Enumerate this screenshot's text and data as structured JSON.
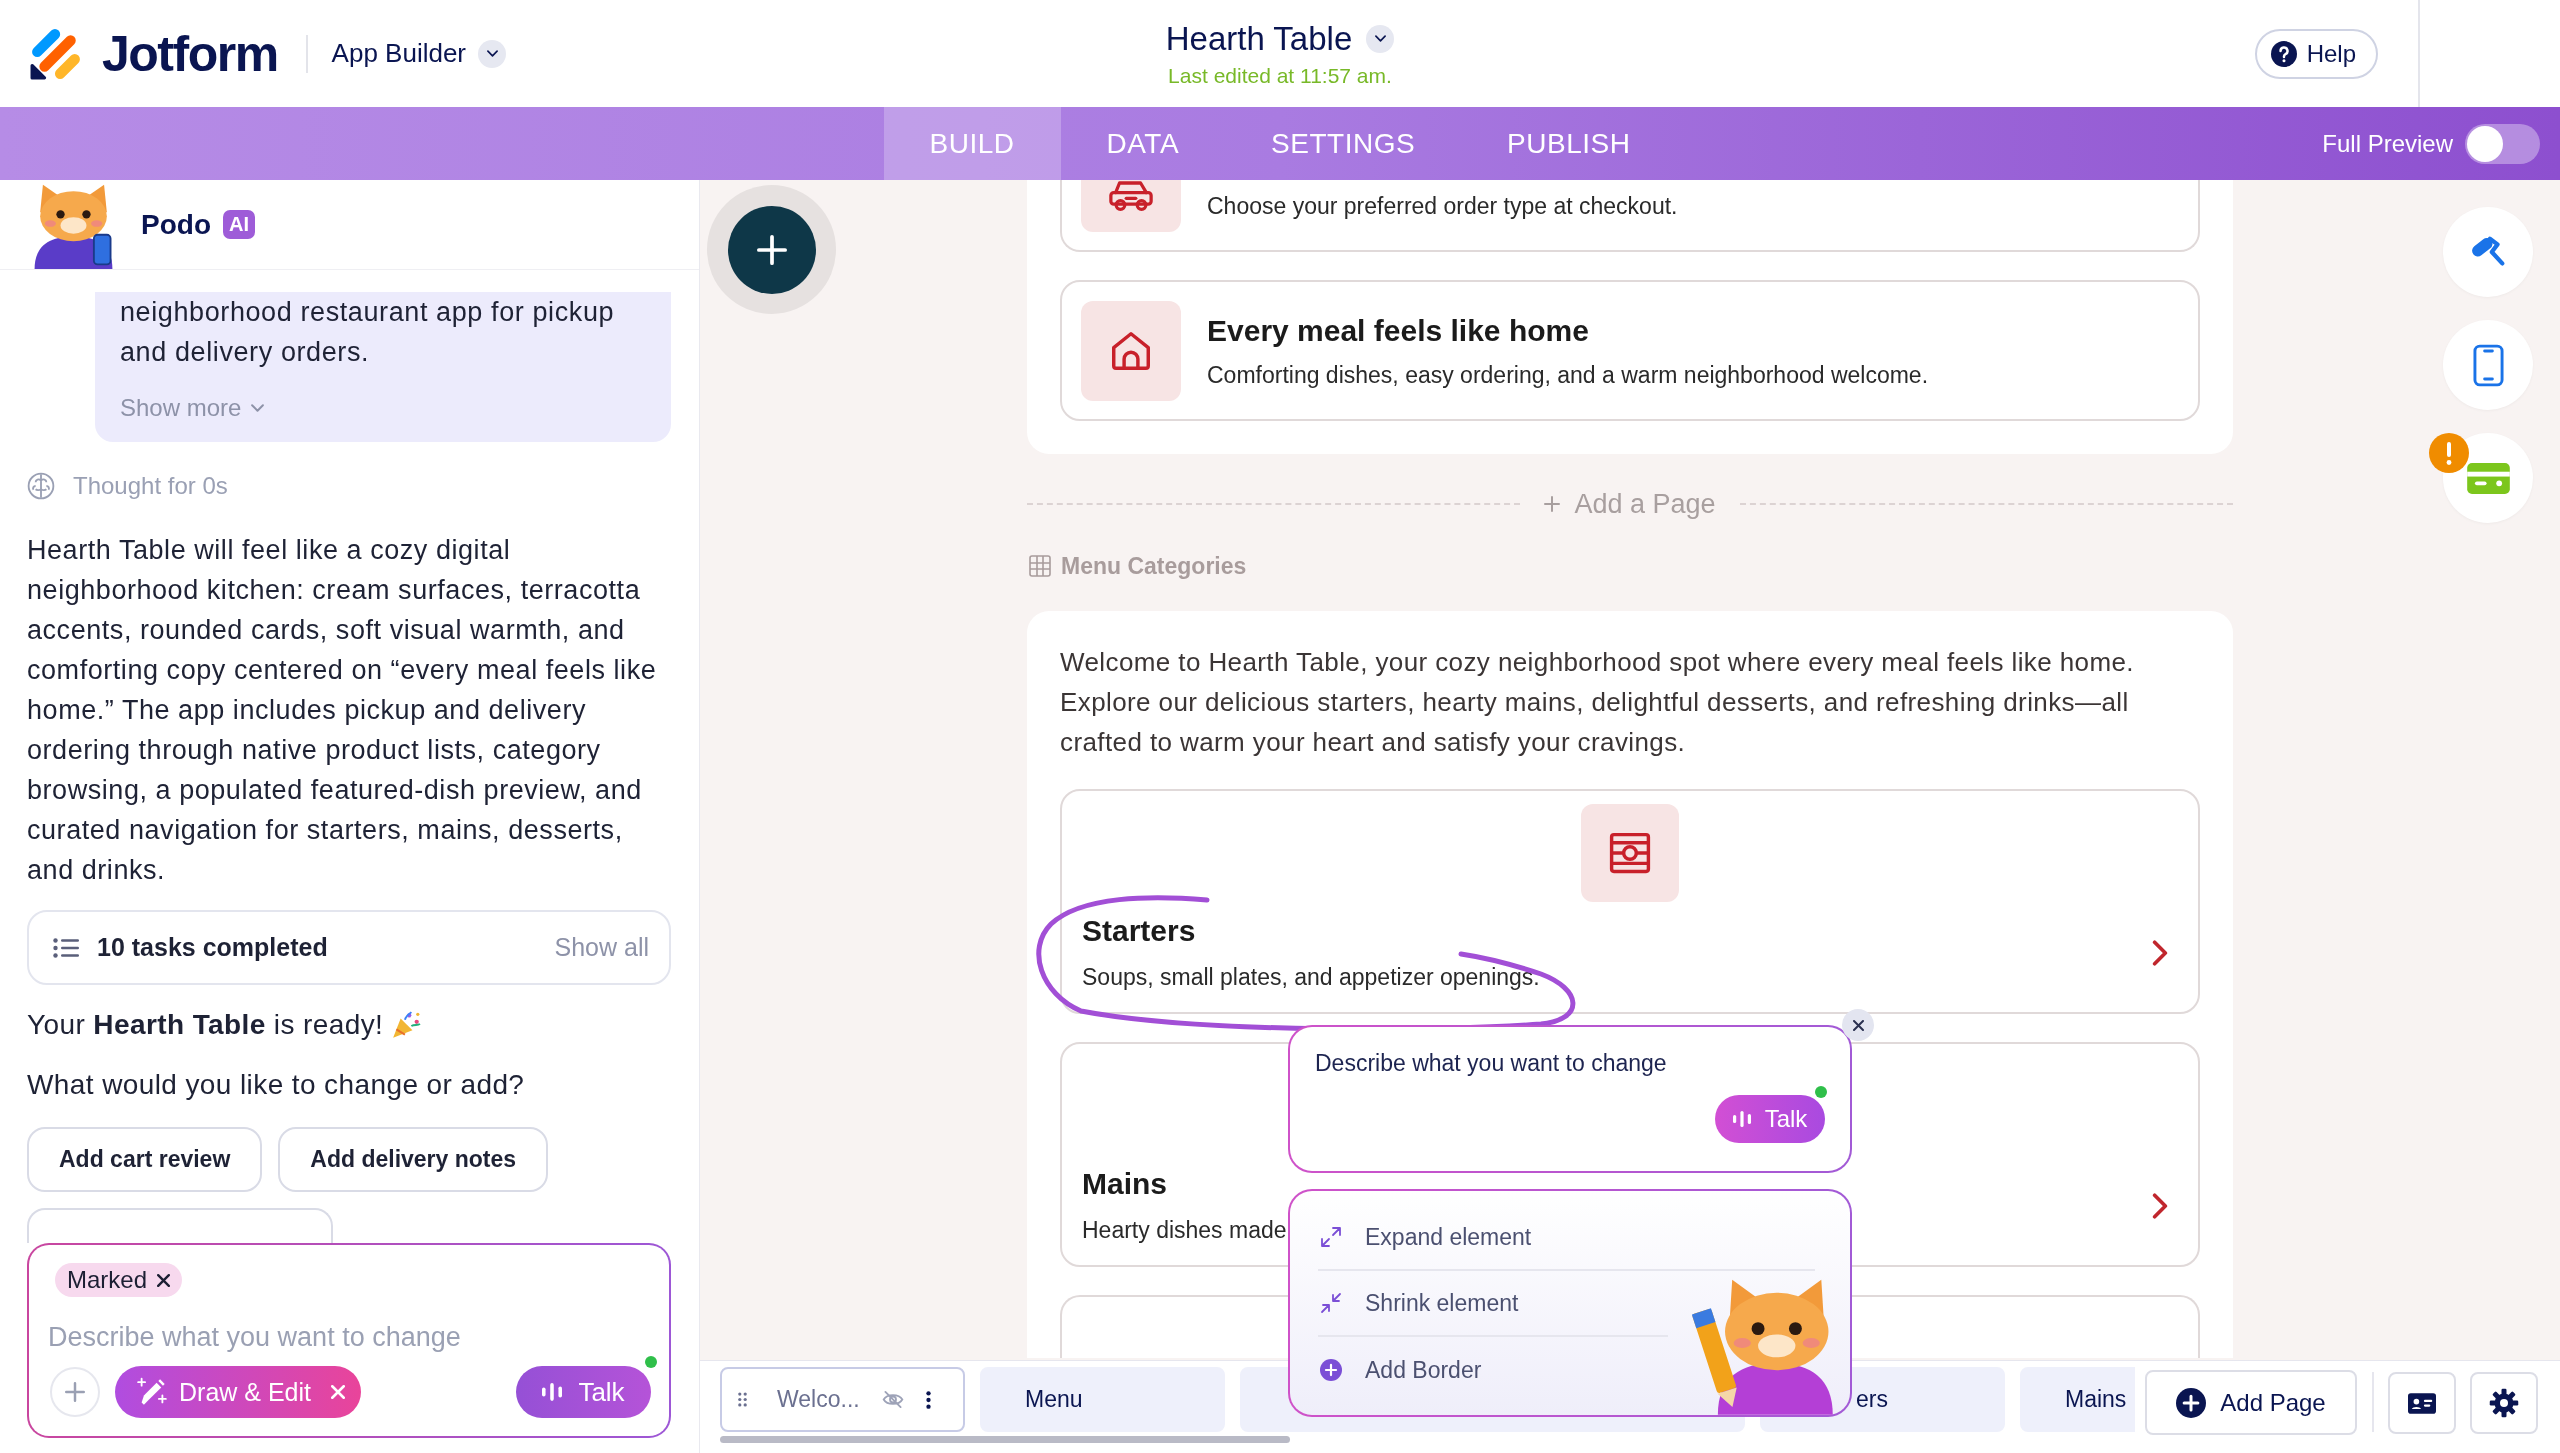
{
  "header": {
    "logo_text": "Jotform",
    "product": "App Builder",
    "app_title": "Hearth Table",
    "last_edited": "Last edited at 11:57 am.",
    "help": "Help"
  },
  "nav": {
    "tabs": [
      {
        "label": "BUILD",
        "selected": true
      },
      {
        "label": "DATA",
        "selected": false
      },
      {
        "label": "SETTINGS",
        "selected": false
      },
      {
        "label": "PUBLISH",
        "selected": false
      }
    ],
    "full_preview": {
      "label": "Full Preview",
      "on": false
    }
  },
  "assistant": {
    "name": "Podo",
    "badge": "AI",
    "request": {
      "text": "neighborhood restaurant app for pickup and delivery orders.",
      "show_more": "Show more"
    },
    "thought": "Thought for 0s",
    "reply": "Hearth Table will feel like a cozy digital neighborhood kitchen: cream surfaces, terracotta accents, rounded cards, soft visual warmth, and comforting copy centered on “every meal feels like home.” The app includes pickup and delivery ordering through native product lists, category browsing, a populated featured-dish preview, and curated navigation for starters, mains, desserts, and drinks.",
    "tasks": {
      "label": "10 tasks completed",
      "action": "Show all"
    },
    "ready": "Your **Hearth Table** is ready!",
    "question": "What would you like to change or add?",
    "suggestions": [
      {
        "kind": "chip",
        "label": "Add cart review"
      },
      {
        "kind": "chip",
        "label": "Add delivery notes"
      },
      {
        "kind": "covered"
      }
    ],
    "composer": {
      "tag": "Marked",
      "placeholder": "Describe what you want to change",
      "draw_button": "Draw & Edit",
      "talk_button": "Talk",
      "mic_ready": true
    }
  },
  "canvas": {
    "order_card": {
      "text": "Choose your preferred order type at checkout."
    },
    "welcome_card": {
      "title": "Every meal feels like home",
      "text": "Comforting dishes, easy ordering, and a warm neighborhood welcome."
    },
    "add_page": "Add a Page",
    "section_label": "Menu Categories",
    "intro": "Welcome to Hearth Table, your cozy neighborhood spot where every meal feels like home. Explore our delicious starters, hearty mains, delightful desserts, and refreshing drinks—all crafted to warm your heart and satisfy your cravings.",
    "categories": [
      {
        "kind": "icon",
        "title": "Starters",
        "text": "Soups, small plates, and appetizer openings.",
        "marked": true
      },
      {
        "kind": "text",
        "title": "Mains",
        "text": "Hearty dishes made",
        "marked": false
      },
      {
        "kind": "covered"
      }
    ]
  },
  "edit_popup": {
    "placeholder": "Describe what you want to change",
    "talk_button": "Talk",
    "mic_ready": true,
    "actions": [
      {
        "kind": "expand",
        "label": "Expand element"
      },
      {
        "kind": "shrink",
        "label": "Shrink element"
      },
      {
        "kind": "add",
        "label": "Add Border"
      }
    ]
  },
  "rail": {
    "payment_alert": true
  },
  "page_bar": {
    "pages": [
      {
        "label": "Welco...",
        "selected": true,
        "kind": "full"
      },
      {
        "label": "Menu",
        "selected": false,
        "kind": "full"
      },
      {
        "selected": false,
        "kind": "covered"
      },
      {
        "label": "ers",
        "selected": false,
        "kind": "covered"
      },
      {
        "label": "Mains",
        "selected": false,
        "kind": "full"
      }
    ],
    "add_page": "Add Page"
  }
}
